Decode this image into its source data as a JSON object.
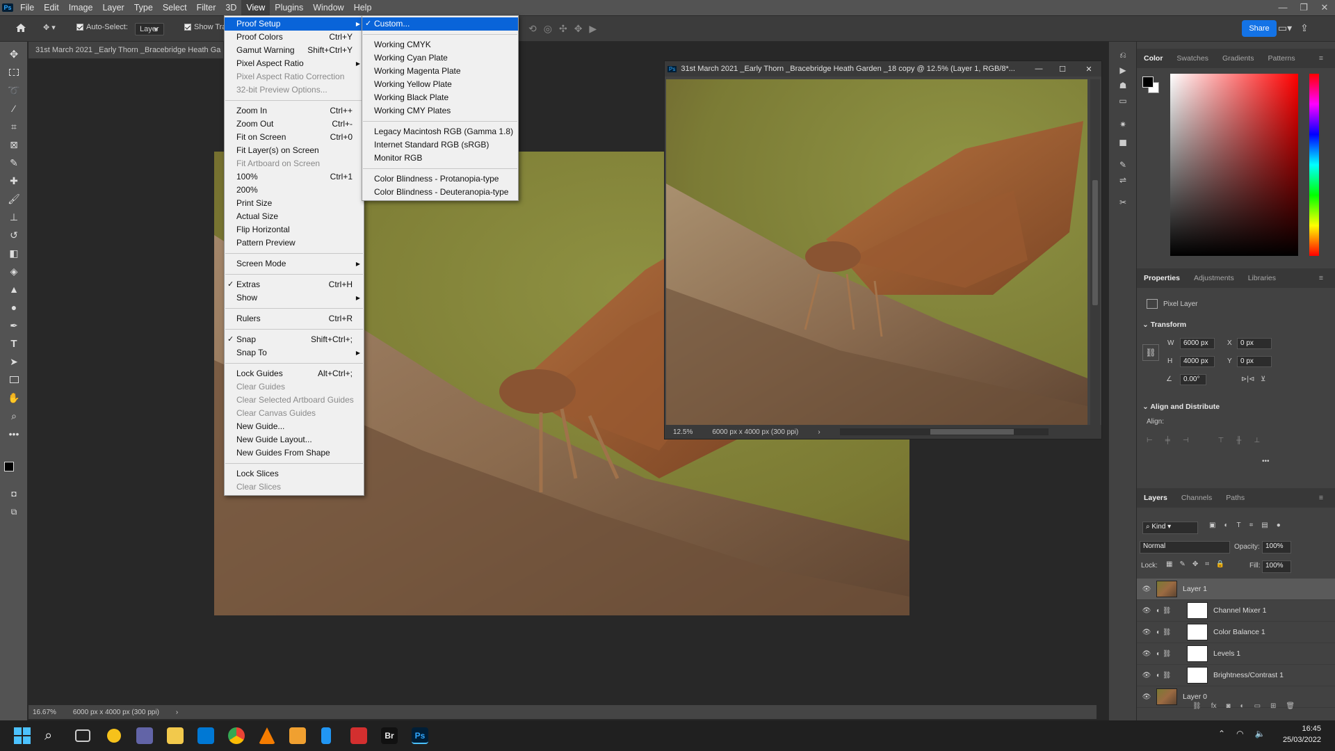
{
  "menubar": {
    "items": [
      "File",
      "Edit",
      "Image",
      "Layer",
      "Type",
      "Select",
      "Filter",
      "3D",
      "View",
      "Plugins",
      "Window",
      "Help"
    ],
    "active": "View"
  },
  "options": {
    "auto_select": "Auto-Select:",
    "layer": "Layer",
    "show_transform": "Show Tra",
    "share": "Share"
  },
  "doc": {
    "tab_title": "31st March 2021 _Early Thorn _Bracebridge Heath Ga",
    "zoom": "16.67%",
    "dims": "6000 px x 4000 px (300 ppi)"
  },
  "float_window": {
    "title": "31st March 2021 _Early Thorn _Bracebridge Heath Garden _18 copy @ 12.5% (Layer 1, RGB/8*...",
    "zoom": "12.5%",
    "dims": "6000 px x 4000 px (300 ppi)"
  },
  "view_menu": {
    "items": [
      {
        "label": "Proof Setup",
        "sub": true,
        "hl": true
      },
      {
        "label": "Proof Colors",
        "sc": "Ctrl+Y"
      },
      {
        "label": "Gamut Warning",
        "sc": "Shift+Ctrl+Y"
      },
      {
        "label": "Pixel Aspect Ratio",
        "sub": true
      },
      {
        "label": "Pixel Aspect Ratio Correction",
        "dis": true
      },
      {
        "label": "32-bit Preview Options...",
        "dis": true
      },
      {
        "sep": true
      },
      {
        "label": "Zoom In",
        "sc": "Ctrl++"
      },
      {
        "label": "Zoom Out",
        "sc": "Ctrl+-"
      },
      {
        "label": "Fit on Screen",
        "sc": "Ctrl+0"
      },
      {
        "label": "Fit Layer(s) on Screen"
      },
      {
        "label": "Fit Artboard on Screen",
        "dis": true
      },
      {
        "label": "100%",
        "sc": "Ctrl+1"
      },
      {
        "label": "200%"
      },
      {
        "label": "Print Size"
      },
      {
        "label": "Actual Size"
      },
      {
        "label": "Flip Horizontal"
      },
      {
        "label": "Pattern Preview"
      },
      {
        "sep": true
      },
      {
        "label": "Screen Mode",
        "sub": true
      },
      {
        "sep": true
      },
      {
        "label": "Extras",
        "sc": "Ctrl+H",
        "check": true
      },
      {
        "label": "Show",
        "sub": true
      },
      {
        "sep": true
      },
      {
        "label": "Rulers",
        "sc": "Ctrl+R"
      },
      {
        "sep": true
      },
      {
        "label": "Snap",
        "sc": "Shift+Ctrl+;",
        "check": true
      },
      {
        "label": "Snap To",
        "sub": true
      },
      {
        "sep": true
      },
      {
        "label": "Lock Guides",
        "sc": "Alt+Ctrl+;"
      },
      {
        "label": "Clear Guides",
        "dis": true
      },
      {
        "label": "Clear Selected Artboard Guides",
        "dis": true
      },
      {
        "label": "Clear Canvas Guides",
        "dis": true
      },
      {
        "label": "New Guide..."
      },
      {
        "label": "New Guide Layout..."
      },
      {
        "label": "New Guides From Shape"
      },
      {
        "sep": true
      },
      {
        "label": "Lock Slices"
      },
      {
        "label": "Clear Slices",
        "dis": true
      }
    ]
  },
  "proof_menu": {
    "items": [
      {
        "label": "Custom...",
        "check": true,
        "hl": true
      },
      {
        "sep": true
      },
      {
        "label": "Working CMYK"
      },
      {
        "label": "Working Cyan Plate"
      },
      {
        "label": "Working Magenta Plate"
      },
      {
        "label": "Working Yellow Plate"
      },
      {
        "label": "Working Black Plate"
      },
      {
        "label": "Working CMY Plates"
      },
      {
        "sep": true
      },
      {
        "label": "Legacy Macintosh RGB (Gamma 1.8)"
      },
      {
        "label": "Internet Standard RGB (sRGB)"
      },
      {
        "label": "Monitor RGB"
      },
      {
        "sep": true
      },
      {
        "label": "Color Blindness - Protanopia-type"
      },
      {
        "label": "Color Blindness - Deuteranopia-type"
      }
    ]
  },
  "color_panel": {
    "tabs": [
      "Color",
      "Swatches",
      "Gradients",
      "Patterns"
    ]
  },
  "properties_panel": {
    "tabs": [
      "Properties",
      "Adjustments",
      "Libraries"
    ],
    "type": "Pixel Layer",
    "transform": "Transform",
    "w_label": "W",
    "w": "6000 px",
    "h_label": "H",
    "h": "4000 px",
    "x_label": "X",
    "x": "0 px",
    "y_label": "Y",
    "y": "0 px",
    "angle": "0.00°",
    "align": "Align and Distribute",
    "align_label": "Align:"
  },
  "layers_panel": {
    "tabs": [
      "Layers",
      "Channels",
      "Paths"
    ],
    "kind": "Kind",
    "blend": "Normal",
    "opacity_label": "Opacity:",
    "opacity": "100%",
    "lock_label": "Lock:",
    "fill_label": "Fill:",
    "fill": "100%",
    "layers": [
      "Layer 1",
      "Channel Mixer 1",
      "Color Balance 1",
      "Levels 1",
      "Brightness/Contrast 1",
      "Layer 0"
    ]
  },
  "taskbar": {
    "time": "16:45",
    "date": "25/03/2022"
  },
  "colors": {
    "accent": "#1473e6",
    "highlight": "#0964d9",
    "menu_bg": "#f0f0f0",
    "panel_bg": "#424242"
  }
}
